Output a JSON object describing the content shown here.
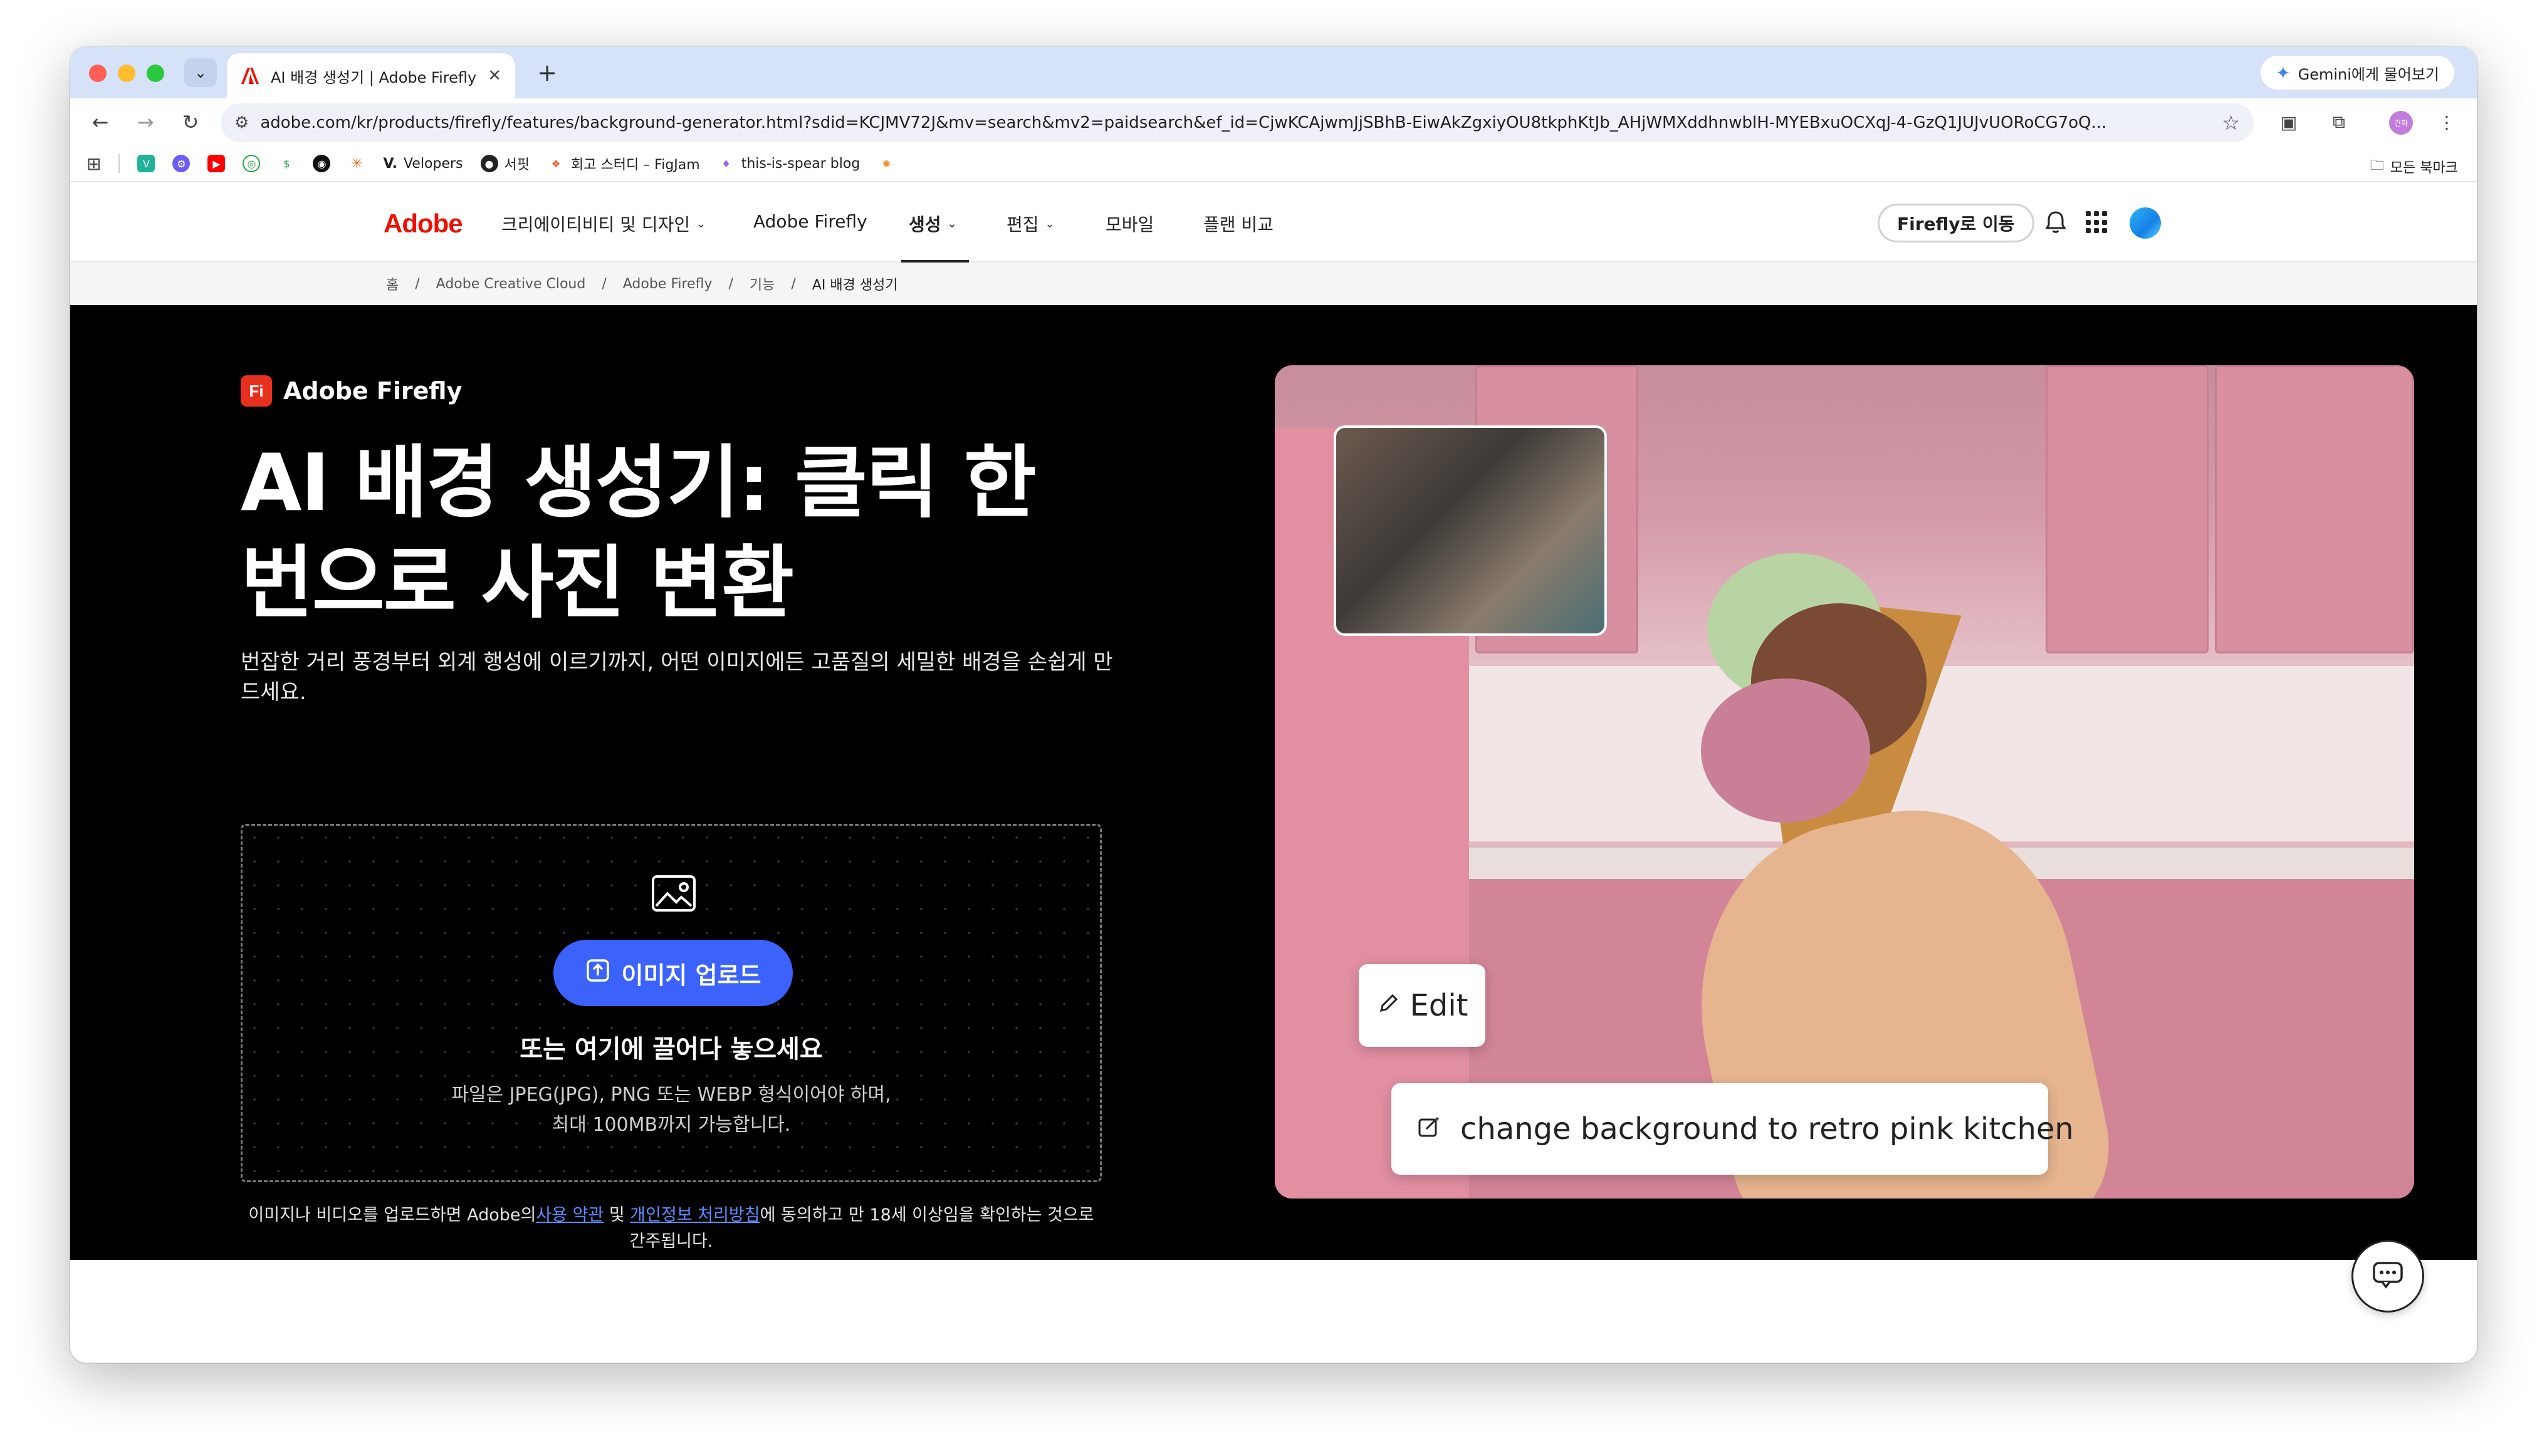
{
  "browser": {
    "tab_title": "AI 배경 생성기 | Adobe Firefly",
    "url": "adobe.com/kr/products/firefly/features/background-generator.html?sdid=KCJMV72J&mv=search&mv2=paidsearch&ef_id=CjwKCAjwmJjSBhB-EiwAkZgxiyOU8tkphKtJb_AHjWMXddhnwblH-MYEBxuOCXqJ-4-GzQ1JUJvUORoCG7oQ...",
    "gemini_label": "Gemini에게 물어보기",
    "profile_label": "건화",
    "bookmarks": [
      {
        "label": "Velopers"
      },
      {
        "label": "서핏"
      },
      {
        "label": "회고 스터디 – FigJam"
      },
      {
        "label": "this-is-spear blog"
      }
    ],
    "all_bookmarks_label": "모든 북마크"
  },
  "gnav": {
    "logo_text": "Adobe",
    "items": [
      {
        "label": "크리에이티비티 및 디자인"
      },
      {
        "label": "Adobe Firefly"
      },
      {
        "label": "생성"
      },
      {
        "label": "편집"
      },
      {
        "label": "모바일"
      },
      {
        "label": "플랜 비교"
      }
    ],
    "cta_label": "Firefly로 이동"
  },
  "breadcrumb": [
    "홈",
    "Adobe Creative Cloud",
    "Adobe Firefly",
    "기능",
    "AI 배경 생성기"
  ],
  "hero": {
    "brand_badge": "Fi",
    "brand_name": "Adobe Firefly",
    "title_line1": "AI 배경 생성기: 클릭 한",
    "title_line2": "번으로 사진 변환",
    "description": "번잡한 거리 풍경부터 외계 행성에 이르기까지, 어떤 이미지에든 고품질의 세밀한 배경을 손쉽게 만드세요.",
    "upload_button": "이미지 업로드",
    "drag_text": "또는 여기에 끌어다 놓으세요",
    "file_info_line1": "파일은 JPEG(JPG), PNG 또는 WEBP 형식이어야 하며,",
    "file_info_line2": "최대 100MB까지 가능합니다.",
    "terms_prefix": "이미지나 비디오를 업로드하면 Adobe의",
    "terms_link1": "사용 약관",
    "terms_and": " 및 ",
    "terms_link2": "개인정보 처리방침",
    "terms_suffix": "에 동의하고 만 18세 이상임을 확인하는 것으로 간주됩니다."
  },
  "demo": {
    "edit_label": "Edit",
    "prompt_text": "change background to retro pink kitchen"
  },
  "colors": {
    "adobe_red": "#eb1000",
    "upload_blue": "#3b63fb",
    "hero_bg": "#000000"
  }
}
